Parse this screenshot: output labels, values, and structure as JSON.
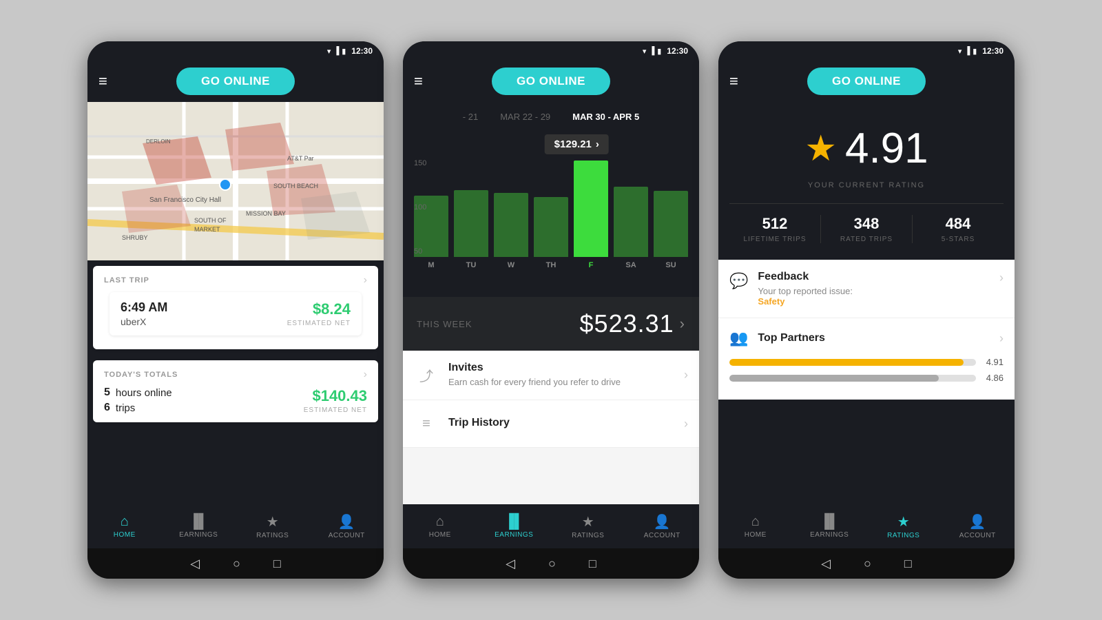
{
  "phone1": {
    "statusBar": {
      "time": "12:30"
    },
    "header": {
      "goOnlineLabel": "GO ONLINE"
    },
    "lastTrip": {
      "label": "LAST TRIP",
      "time": "6:49 AM",
      "type": "uberX",
      "amount": "$8.24",
      "amountLabel": "ESTIMATED NET"
    },
    "todaysTotals": {
      "label": "TODAY'S TOTALS",
      "hours": "5",
      "hoursLabel": "hours online",
      "trips": "6",
      "tripsLabel": "trips",
      "amount": "$140.43",
      "amountLabel": "ESTIMATED NET"
    },
    "nav": {
      "items": [
        {
          "id": "home",
          "label": "HOME",
          "active": true
        },
        {
          "id": "earnings",
          "label": "EARNINGS",
          "active": false
        },
        {
          "id": "ratings",
          "label": "RATINGS",
          "active": false
        },
        {
          "id": "account",
          "label": "ACCOUNT",
          "active": false
        }
      ]
    }
  },
  "phone2": {
    "statusBar": {
      "time": "12:30"
    },
    "header": {
      "goOnlineLabel": "GO ONLINE"
    },
    "weeks": [
      {
        "label": "- 21",
        "active": false
      },
      {
        "label": "MAR 22 - 29",
        "active": false
      },
      {
        "label": "MAR 30 - APR 5",
        "active": true
      }
    ],
    "earningsPopup": "$129.21",
    "chart": {
      "days": [
        "M",
        "TU",
        "W",
        "TH",
        "F",
        "SA",
        "SU"
      ],
      "values": [
        100,
        110,
        105,
        98,
        158,
        115,
        108
      ],
      "activeIndex": 4,
      "yLabels": [
        "150",
        "100",
        "50"
      ]
    },
    "thisWeek": {
      "label": "THIS WEEK",
      "amount": "$523.31"
    },
    "invites": {
      "title": "Invites",
      "desc": "Earn cash for every friend you refer to drive"
    },
    "tripHistory": {
      "title": "Trip History"
    },
    "nav": {
      "items": [
        {
          "id": "home",
          "label": "HOME",
          "active": false
        },
        {
          "id": "earnings",
          "label": "EARNINGS",
          "active": true
        },
        {
          "id": "ratings",
          "label": "RATINGS",
          "active": false
        },
        {
          "id": "account",
          "label": "ACCOUNT",
          "active": false
        }
      ]
    }
  },
  "phone3": {
    "statusBar": {
      "time": "12:30"
    },
    "header": {
      "goOnlineLabel": "GO ONLINE"
    },
    "rating": {
      "value": "4.91",
      "label": "YOUR  CURRENT RATING"
    },
    "stats": [
      {
        "number": "512",
        "label": "LIFETIME TRIPS"
      },
      {
        "number": "348",
        "label": "RATED TRIPS"
      },
      {
        "number": "484",
        "label": "5-STARS"
      }
    ],
    "feedback": {
      "title": "Feedback",
      "sub": "Your top reported issue:",
      "issue": "Safety"
    },
    "topPartners": {
      "title": "Top Partners",
      "bars": [
        {
          "value": "4.91",
          "pct": 95,
          "color": "#f5b200"
        },
        {
          "value": "4.86",
          "pct": 85,
          "color": "#aaa"
        }
      ]
    },
    "nav": {
      "items": [
        {
          "id": "home",
          "label": "HOME",
          "active": false
        },
        {
          "id": "earnings",
          "label": "EARNINGS",
          "active": false
        },
        {
          "id": "ratings",
          "label": "RATINGS",
          "active": true
        },
        {
          "id": "account",
          "label": "ACCOUNT",
          "active": false
        }
      ]
    }
  }
}
